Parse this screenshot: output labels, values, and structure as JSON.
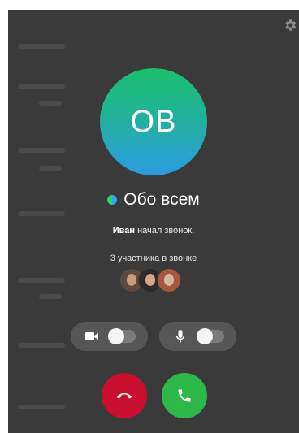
{
  "call": {
    "avatar_initials": "ОВ",
    "chat_title": "Обо всем",
    "started_by": "Иван",
    "started_text": "начал звонок.",
    "participants_text": "3 участника в звонке"
  },
  "controls": {
    "video_enabled": false,
    "mic_enabled": false
  },
  "icons": {
    "settings": "gear-icon",
    "video": "video-camera-icon",
    "mic": "microphone-icon",
    "decline": "hang-up-icon",
    "accept": "phone-icon"
  },
  "colors": {
    "background": "#3a3a3a",
    "decline": "#c8102e",
    "accept": "#2db84a",
    "avatar_top": "#1bbf6e",
    "avatar_bottom": "#2b9ce0"
  }
}
